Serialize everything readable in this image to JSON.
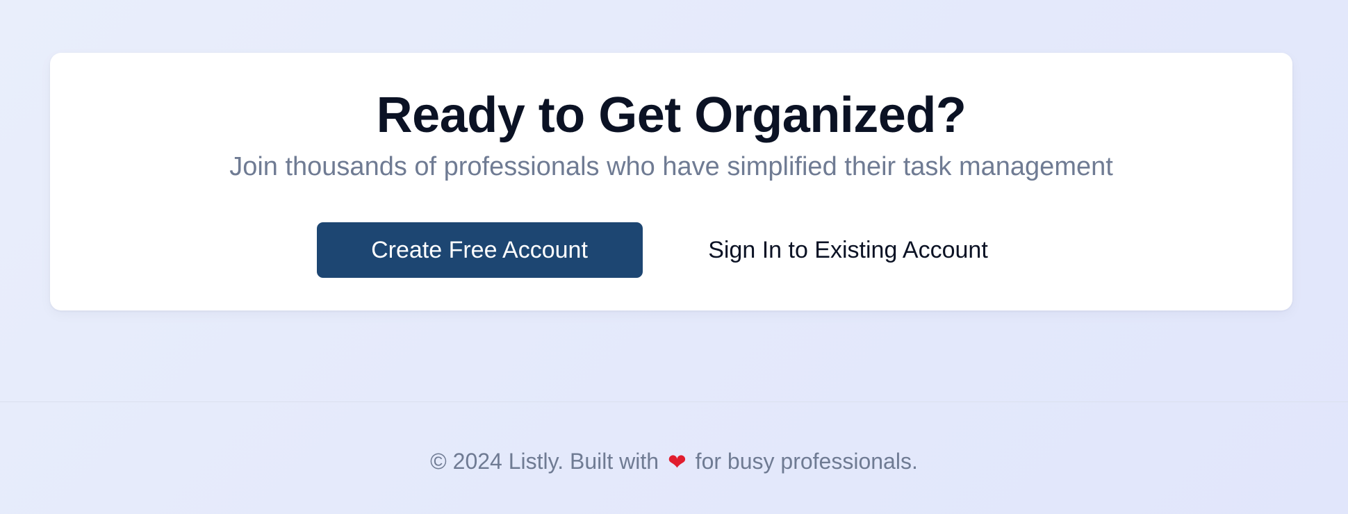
{
  "cta": {
    "title": "Ready to Get Organized?",
    "subtitle": "Join thousands of professionals who have simplified their task management",
    "primary_button": "Create Free Account",
    "secondary_button": "Sign In to Existing Account"
  },
  "footer": {
    "text_before": "© 2024 Listly. Built with",
    "heart": "❤",
    "text_after": "for busy professionals."
  },
  "colors": {
    "primary_button_bg": "#1d4672",
    "heart": "#e11d2e"
  }
}
